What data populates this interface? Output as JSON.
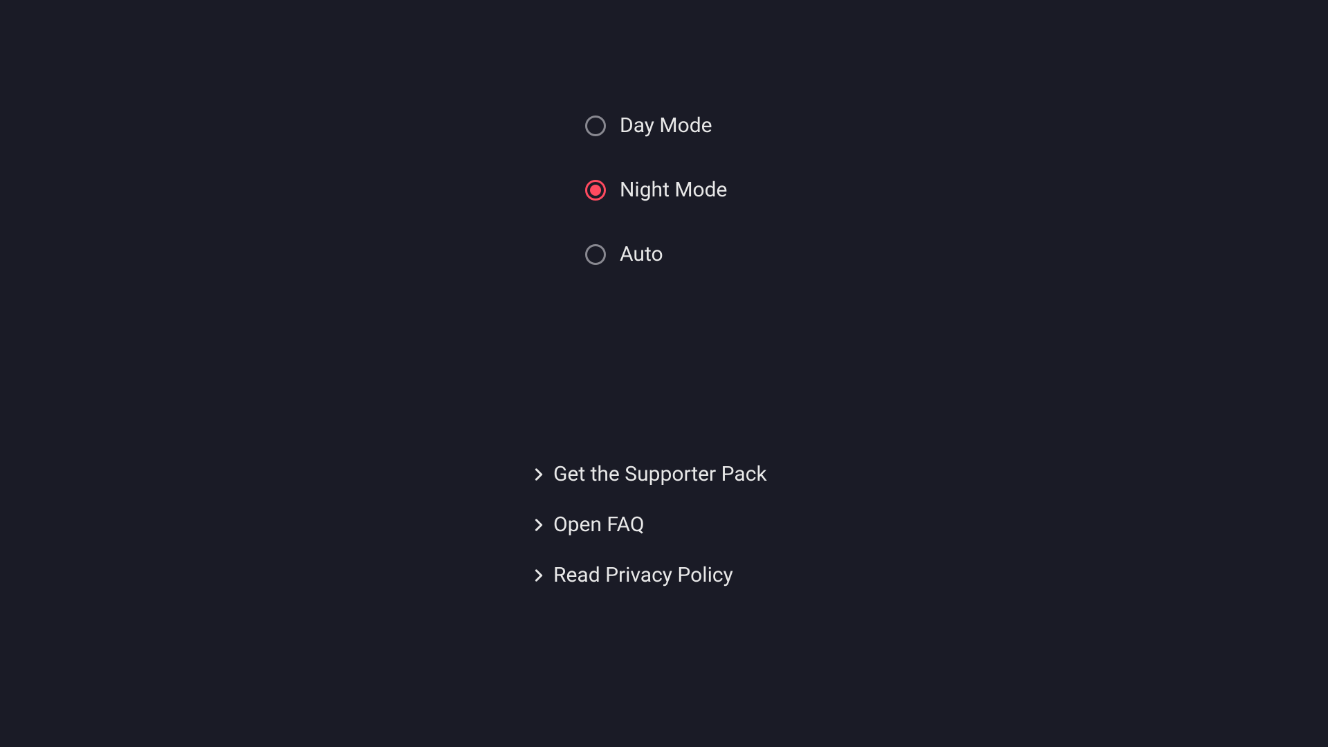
{
  "theme": {
    "options": [
      {
        "label": "Day Mode",
        "selected": false
      },
      {
        "label": "Night Mode",
        "selected": true
      },
      {
        "label": "Auto",
        "selected": false
      }
    ]
  },
  "links": [
    {
      "label": "Get the Supporter Pack"
    },
    {
      "label": "Open FAQ"
    },
    {
      "label": "Read Privacy Policy"
    }
  ]
}
